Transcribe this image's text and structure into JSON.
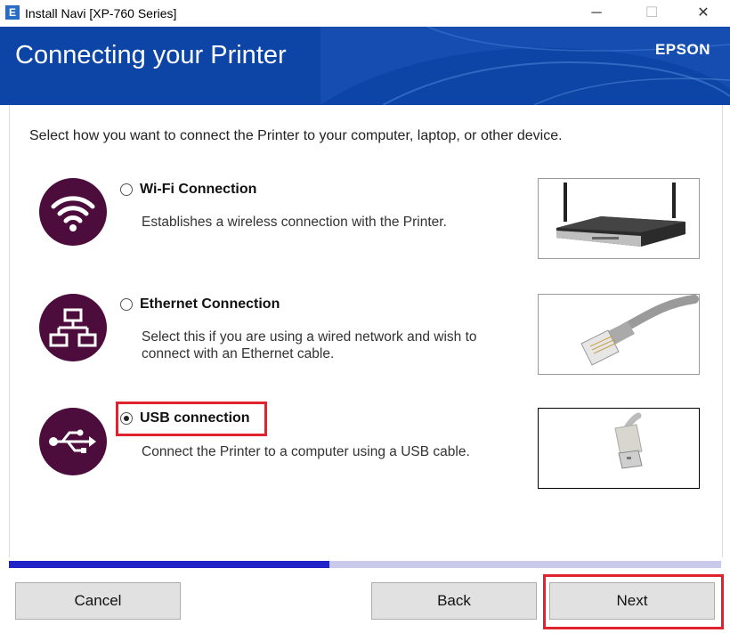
{
  "window": {
    "title": "Install Navi [XP-760 Series]",
    "app_icon": "E",
    "controls": {
      "minimize": "─",
      "maximize": "☐",
      "close": "✕"
    }
  },
  "header": {
    "title": "Connecting your Printer",
    "logo": "EPSON",
    "background_color": "#0d45a6"
  },
  "main": {
    "instruction": "Select how you want to connect the Printer to your computer, laptop, or other device.",
    "options": [
      {
        "label": "Wi-Fi Connection",
        "description": "Establishes a wireless connection with the Printer.",
        "icon": "wifi-icon",
        "image": "router-image",
        "selected": false
      },
      {
        "label": "Ethernet Connection",
        "description": "Select this if you are using a wired network and wish to connect with an Ethernet cable.",
        "icon": "network-icon",
        "image": "ethernet-cable-image",
        "selected": false
      },
      {
        "label": "USB connection",
        "description": "Connect the Printer to a computer using a USB cable.",
        "icon": "usb-icon",
        "image": "usb-cable-image",
        "selected": true
      }
    ],
    "icon_color": "#4c0d3c"
  },
  "progress": {
    "value": 0.45,
    "fill_color": "#1f22c7",
    "track_color": "#c9c9ec"
  },
  "footer": {
    "cancel_label": "Cancel",
    "back_label": "Back",
    "next_label": "Next"
  },
  "highlight_color": "#e0242f"
}
